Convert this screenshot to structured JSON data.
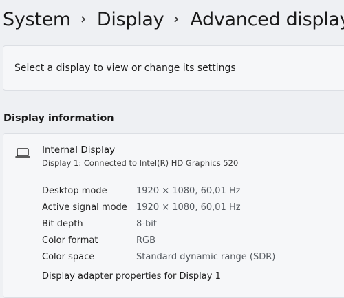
{
  "breadcrumb": {
    "items": [
      "System",
      "Display",
      "Advanced display"
    ]
  },
  "selector": {
    "label": "Select a display to view or change its settings"
  },
  "section": {
    "title": "Display information"
  },
  "display": {
    "icon": "monitor-icon",
    "name": "Internal Display",
    "subtitle": "Display 1: Connected to Intel(R) HD Graphics 520"
  },
  "properties": [
    {
      "label": "Desktop mode",
      "value": "1920 × 1080, 60,01 Hz"
    },
    {
      "label": "Active signal mode",
      "value": "1920 × 1080, 60,01 Hz"
    },
    {
      "label": "Bit depth",
      "value": "8-bit"
    },
    {
      "label": "Color format",
      "value": "RGB"
    },
    {
      "label": "Color space",
      "value": "Standard dynamic range (SDR)"
    }
  ],
  "adapter_link": "Display adapter properties for Display 1",
  "colors": {
    "background": "#eef0f3",
    "card": "#f6f7f9",
    "value_text": "#555a60"
  }
}
